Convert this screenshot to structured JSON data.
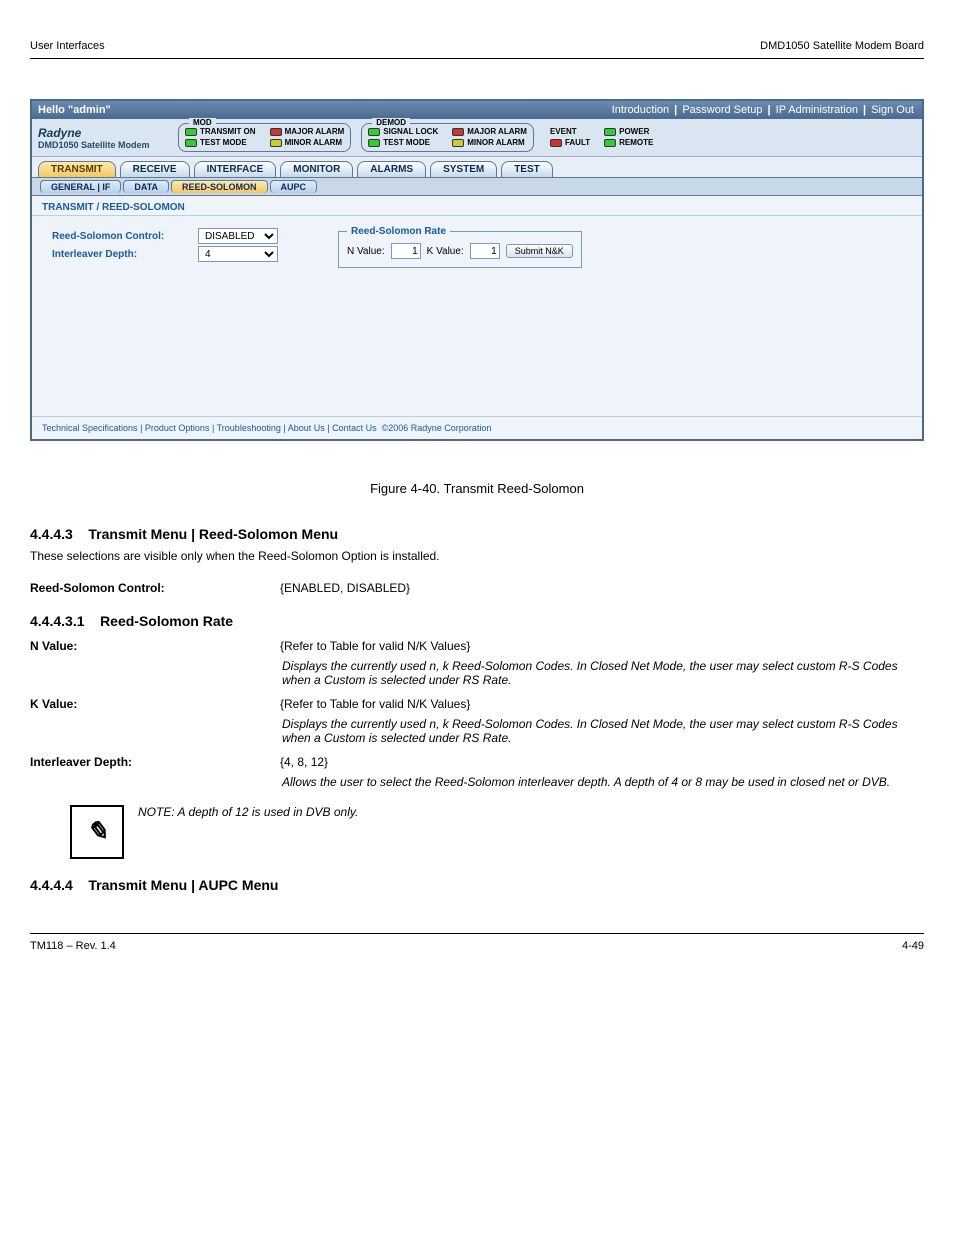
{
  "doc": {
    "left_header": "User Interfaces",
    "right_header": "DMD1050 Satellite Modem Board",
    "footer_left": "TM118 – Rev. 1.4",
    "footer_right": "4-49"
  },
  "hello": {
    "greeting": "Hello \"admin\"",
    "links": [
      "Introduction",
      "Password Setup",
      "IP Administration",
      "Sign Out"
    ]
  },
  "logo": {
    "brand": "Radyne",
    "model": "DMD1050 Satellite Modem"
  },
  "status": {
    "mod_title": "MOD",
    "demod_title": "DEMOD",
    "mod": {
      "transmit_on": "TRANSMIT ON",
      "test_mode": "TEST MODE",
      "major": "MAJOR ALARM",
      "minor": "MINOR ALARM"
    },
    "demod": {
      "signal_lock": "SIGNAL LOCK",
      "test_mode": "TEST MODE",
      "major": "MAJOR ALARM",
      "minor": "MINOR ALARM"
    },
    "sys": {
      "event": "EVENT",
      "fault": "FAULT",
      "power": "POWER",
      "remote": "REMOTE"
    }
  },
  "tabs": {
    "main": [
      "TRANSMIT",
      "RECEIVE",
      "INTERFACE",
      "MONITOR",
      "ALARMS",
      "SYSTEM",
      "TEST"
    ],
    "sub": [
      "GENERAL | IF",
      "DATA",
      "REED-SOLOMON",
      "AUPC"
    ]
  },
  "content": {
    "title": "TRANSMIT / REED-SOLOMON",
    "rs_control_label": "Reed-Solomon Control:",
    "interleaver_label": "Interleaver Depth:",
    "rs_control_value": "DISABLED",
    "interleaver_value": "4",
    "fieldset_title": "Reed-Solomon Rate",
    "n_label": "N Value:",
    "k_label": "K Value:",
    "n_value": "1",
    "k_value": "1",
    "submit_label": "Submit N&K"
  },
  "footer": {
    "links": [
      "Technical Specifications",
      "Product Options",
      "Troubleshooting",
      "About Us",
      "Contact Us"
    ],
    "copyright": "©2006 Radyne Corporation"
  },
  "figure_caption": "Figure 4-40. Transmit Reed-Solomon",
  "sections": {
    "num1": "4.4.4.3",
    "title1": "Transmit Menu | Reed-Solomon Menu",
    "para1": "These selections are visible only when the Reed-Solomon Option is installed.",
    "rs_control_term": "Reed-Solomon Control:",
    "rs_control_opts": "{ENABLED, DISABLED}",
    "num2": "4.4.4.3.1",
    "title2": "Reed-Solomon Rate",
    "n_term": "N Value:",
    "k_term": "K Value:",
    "nk_desc1": "{Refer to Table for valid N/K Values}",
    "nk_desc2": "Displays the currently used n, k Reed-Solomon Codes. In Closed Net Mode, the user may select custom R-S Codes when a Custom is selected under RS Rate.",
    "inter_term": "Interleaver Depth:",
    "inter_opts": "{4, 8, 12}",
    "inter_desc": "Allows the user to select the Reed-Solomon interleaver depth. A depth of 4 or 8 may be used in closed net or DVB.",
    "note": "NOTE: A depth of 12 is used in DVB only.",
    "num3": "4.4.4.4",
    "title3": "Transmit Menu | AUPC Menu"
  }
}
